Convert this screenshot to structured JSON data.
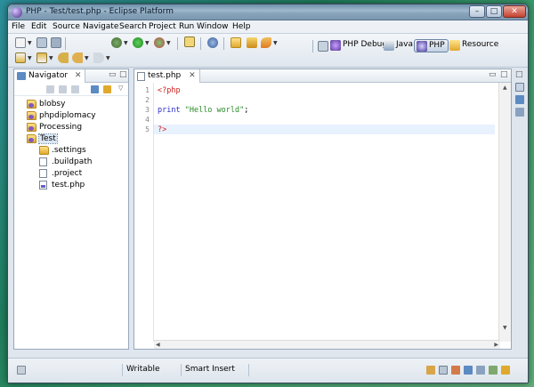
{
  "window": {
    "title": "PHP - Test/test.php - Eclipse Platform",
    "buttons": {
      "minimize": "–",
      "maximize": "□",
      "close": "✕"
    }
  },
  "menu": [
    {
      "label": "File"
    },
    {
      "label": "Edit"
    },
    {
      "label": "Source"
    },
    {
      "label": "Navigate"
    },
    {
      "label": "Search"
    },
    {
      "label": "Project"
    },
    {
      "label": "Run"
    },
    {
      "label": "Window"
    },
    {
      "label": "Help"
    }
  ],
  "perspectives": [
    {
      "label": "PHP Debug",
      "icon": "debug-perspective-icon"
    },
    {
      "label": "Java",
      "icon": "java-perspective-icon"
    },
    {
      "label": "PHP",
      "icon": "php-perspective-icon",
      "active": true
    },
    {
      "label": "Resource",
      "icon": "resource-perspective-icon"
    }
  ],
  "navigator": {
    "tab_label": "Navigator",
    "tab_close": "✕",
    "tree": [
      {
        "label": "blobsy",
        "type": "project",
        "depth": 0
      },
      {
        "label": "phpdiplomacy",
        "type": "project",
        "depth": 0
      },
      {
        "label": "Processing",
        "type": "project",
        "depth": 0
      },
      {
        "label": "Test",
        "type": "project",
        "depth": 0,
        "selected": true
      },
      {
        "label": ".settings",
        "type": "folder",
        "depth": 1
      },
      {
        "label": ".buildpath",
        "type": "file",
        "depth": 1
      },
      {
        "label": ".project",
        "type": "file",
        "depth": 1
      },
      {
        "label": "test.php",
        "type": "php-file",
        "depth": 1
      }
    ]
  },
  "editor": {
    "tab_label": "test.php",
    "tab_close": "✕",
    "current_line": 5,
    "lines": [
      {
        "num": "1",
        "tokens": [
          {
            "text": "<?php",
            "color": "#cc2222"
          }
        ]
      },
      {
        "num": "2",
        "tokens": []
      },
      {
        "num": "3",
        "tokens": [
          {
            "text": "print",
            "color": "#2d2dc8"
          },
          {
            "text": " ",
            "color": "#000000"
          },
          {
            "text": "\"Hello world\"",
            "color": "#2a8a2a"
          },
          {
            "text": ";",
            "color": "#000000"
          }
        ]
      },
      {
        "num": "4",
        "tokens": []
      },
      {
        "num": "5",
        "tokens": [
          {
            "text": "?>",
            "color": "#cc2222"
          }
        ]
      }
    ]
  },
  "statusbar": {
    "mode": "Writable",
    "insert": "Smart Insert"
  },
  "colors": {
    "keyword_php_tag": "#cc2222",
    "keyword": "#2d2dc8",
    "string": "#2a8a2a",
    "current_line_bg": "#e8f2fe",
    "selection_bg": "#dbe6f3"
  }
}
